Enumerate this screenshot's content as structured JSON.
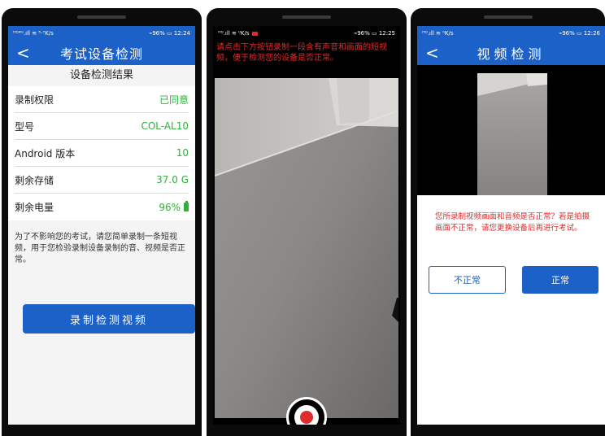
{
  "colors": {
    "primary": "#1b61c7",
    "success": "#2eb03a",
    "danger": "#e02b2b"
  },
  "screen1": {
    "status": {
      "left": "ᴴᴰ⁴ᴳ.ıll ≋ ⁵·⁷K/s",
      "right": "⌁96% ▭ 12:24"
    },
    "appbar": {
      "back_icon": "chevron-left-icon",
      "back_glyph": "<",
      "title": "考试设备检测"
    },
    "section_title": "设备检测结果",
    "rows": [
      {
        "label": "录制权限",
        "value": "已同意"
      },
      {
        "label": "型号",
        "value": "COL-AL10"
      },
      {
        "label": "Android 版本",
        "value": "10"
      },
      {
        "label": "剩余存储",
        "value": "37.0 G"
      },
      {
        "label": "剩余电量",
        "value": "96%",
        "icon": "battery-icon"
      }
    ],
    "notice": "为了不影响您的考试，请您简单录制一条短视频，用于您检验录制设备录制的音、视频是否正常。",
    "record_button": "录制检测视频"
  },
  "screen2": {
    "status": {
      "left": "ᴴᴰ.ıll ≋ ⁰K/s",
      "right": "⌁96% ▭ 12:25"
    },
    "hint": "请点击下方按钮录制一段含有声音和画面的短视频，便于检测您的设备是否正常。",
    "record_icon": "record-icon"
  },
  "screen3": {
    "status": {
      "left": "ᴴᴰ.ıll ≋ ⁰K/s",
      "right": "⌁96% ▭ 12:26"
    },
    "appbar": {
      "back_icon": "chevron-left-icon",
      "back_glyph": "<",
      "title": "视频检测"
    },
    "dialog_message": "您所录制视频画面和音频是否正常？若是拍摄画面不正常，请您更换设备后再进行考试。",
    "abnormal_button": "不正常",
    "normal_button": "正常"
  }
}
